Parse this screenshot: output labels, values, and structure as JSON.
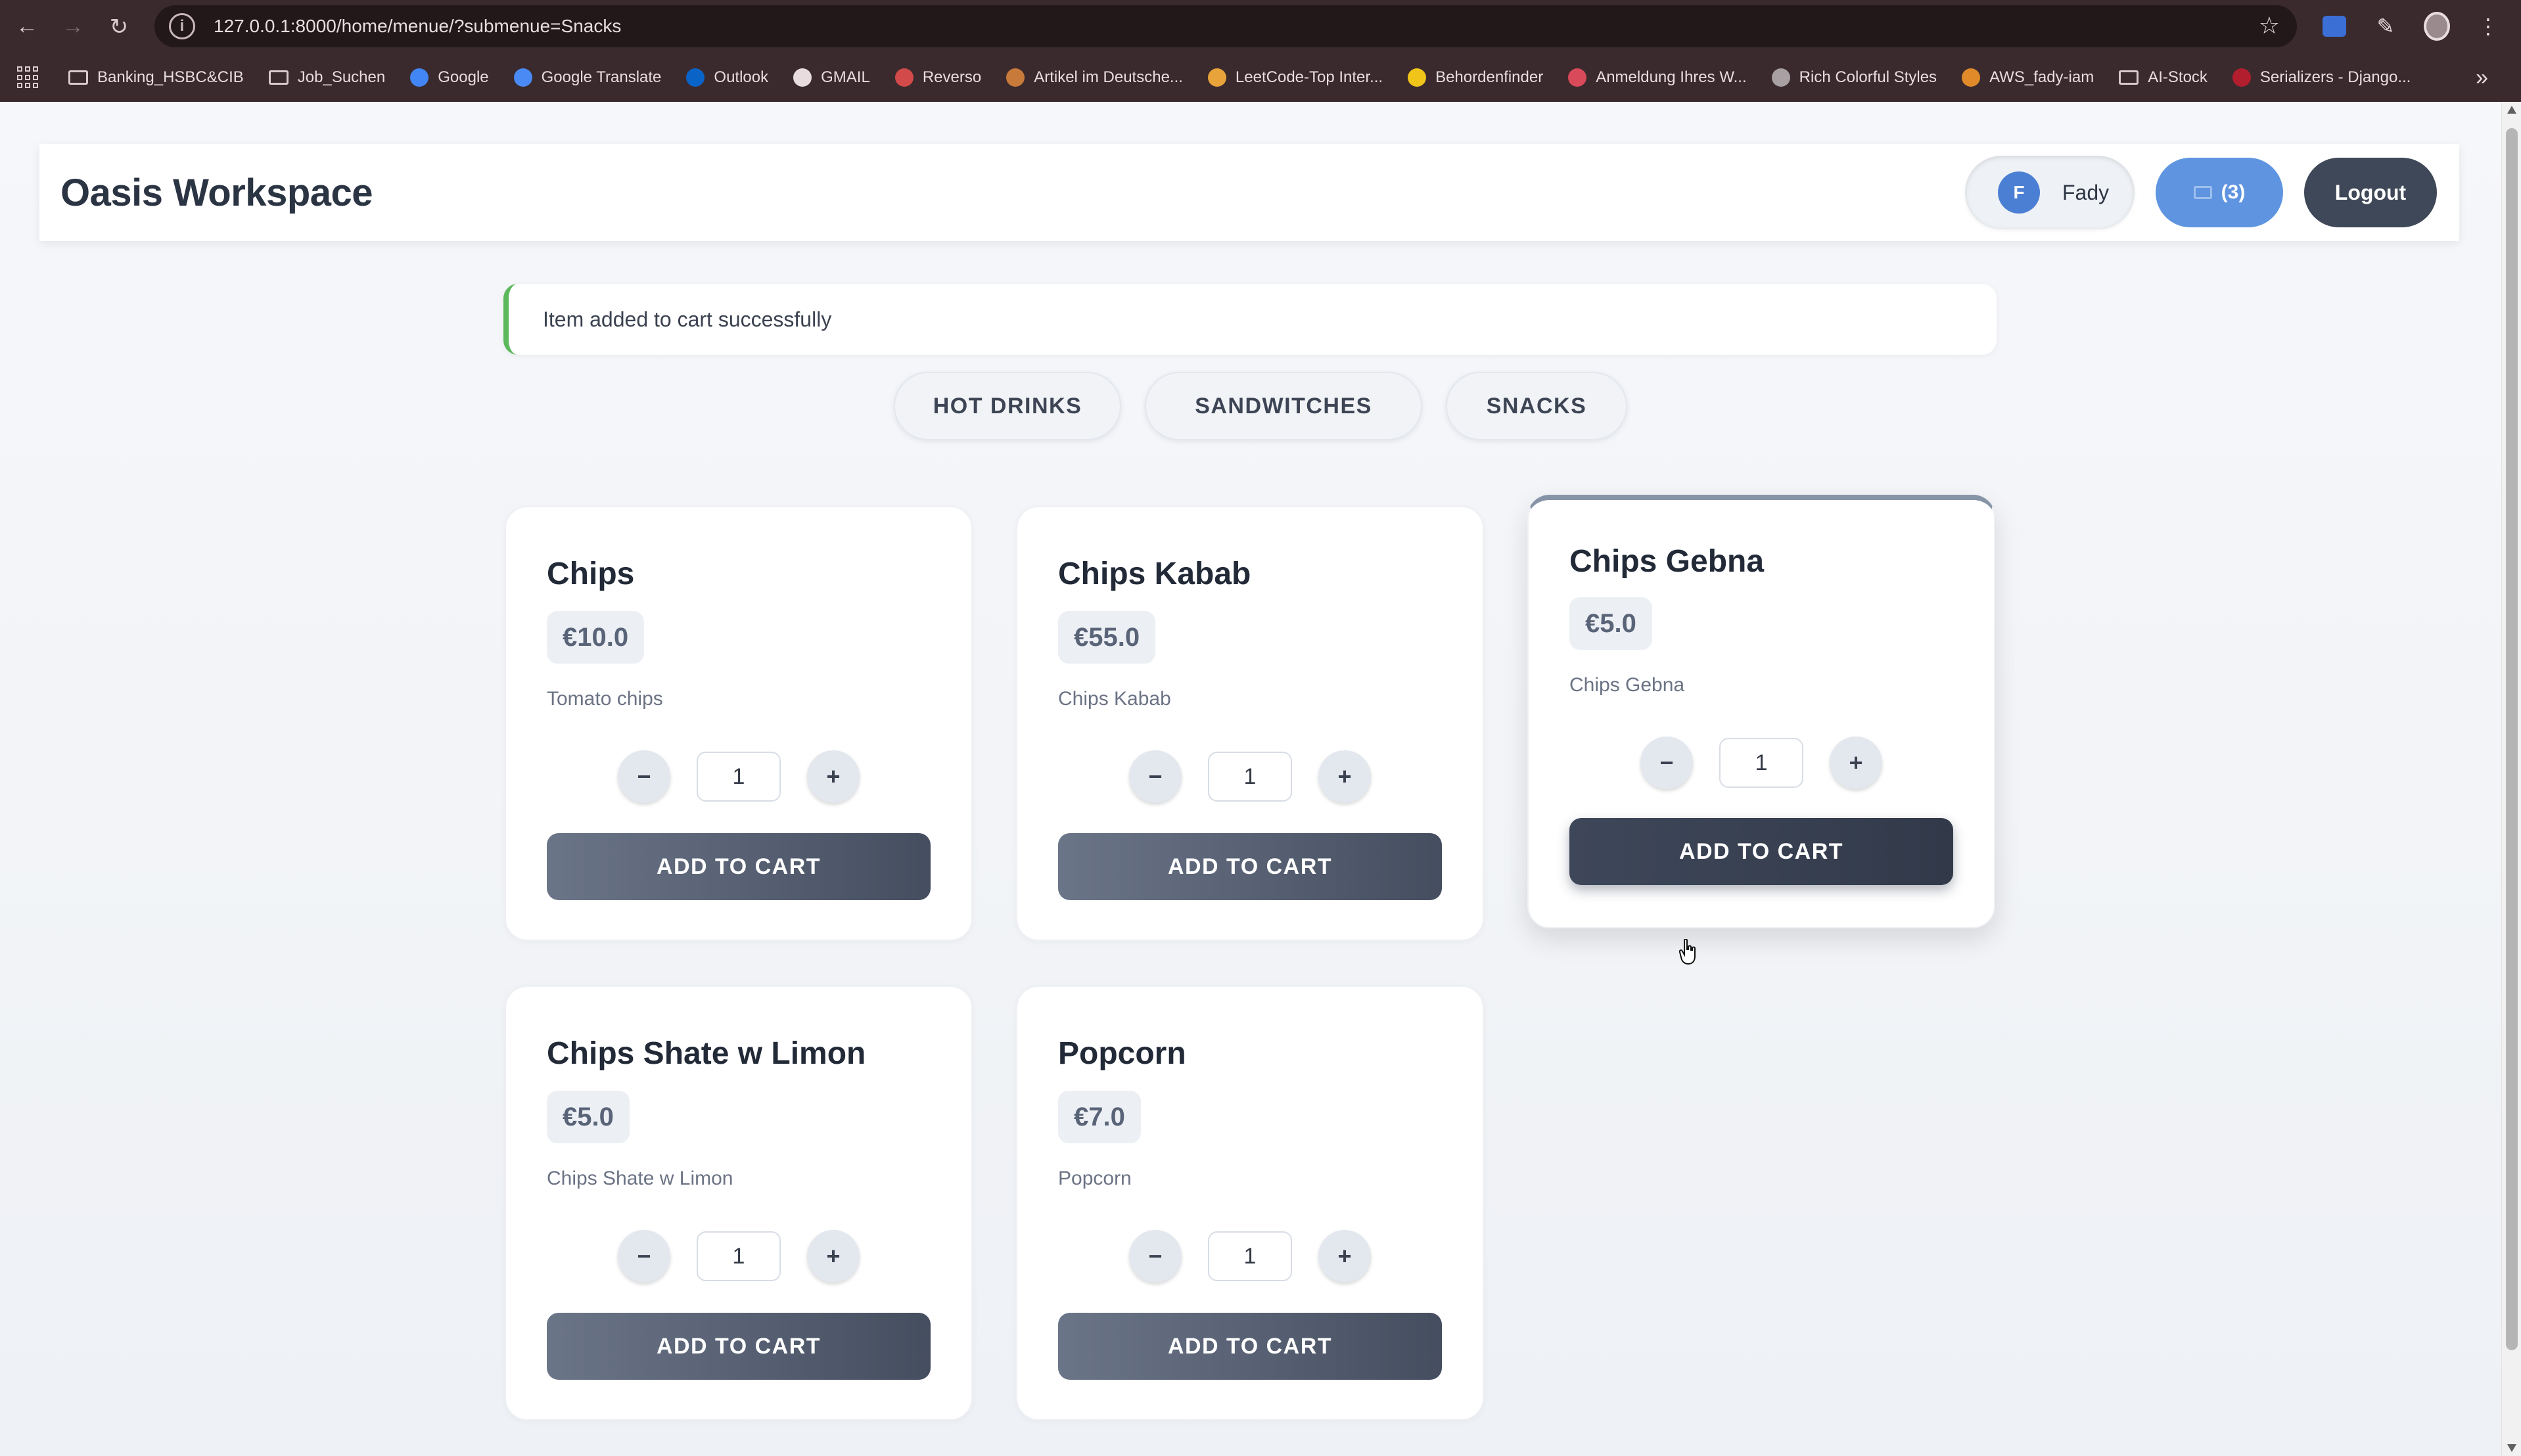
{
  "browser": {
    "url": "127.0.0.1:8000/home/menue/?submenue=Snacks",
    "bookmarks": [
      {
        "label": "Banking_HSBC&CIB",
        "icon": "folder-icon",
        "color": "#d8c9cc"
      },
      {
        "label": "Job_Suchen",
        "icon": "folder-icon",
        "color": "#d8c9cc"
      },
      {
        "label": "Google",
        "icon": "google-icon",
        "color": "#4285f4"
      },
      {
        "label": "Google Translate",
        "icon": "translate-icon",
        "color": "#4a8af4"
      },
      {
        "label": "Outlook",
        "icon": "outlook-icon",
        "color": "#0a64c8"
      },
      {
        "label": "GMAIL",
        "icon": "gmail-icon",
        "color": "#e8dcde"
      },
      {
        "label": "Reverso",
        "icon": "reverso-icon",
        "color": "#d24a4a"
      },
      {
        "label": "Artikel im Deutsche...",
        "icon": "article-icon",
        "color": "#c87a3a"
      },
      {
        "label": "LeetCode-Top Inter...",
        "icon": "leetcode-icon",
        "color": "#e8a33a"
      },
      {
        "label": "Behordenfinder",
        "icon": "behoerden-icon",
        "color": "#f0c419"
      },
      {
        "label": "Anmeldung Ihres W...",
        "icon": "anmeldung-icon",
        "color": "#d84a5a"
      },
      {
        "label": "Rich Colorful Styles",
        "icon": "globe-icon",
        "color": "#a8a0a2"
      },
      {
        "label": "AWS_fady-iam",
        "icon": "aws-icon",
        "color": "#e08a2a"
      },
      {
        "label": "AI-Stock",
        "icon": "folder-icon",
        "color": "#d8c9cc"
      },
      {
        "label": "Serializers - Django...",
        "icon": "django-icon",
        "color": "#b21e2e"
      }
    ]
  },
  "header": {
    "brand": "Oasis Workspace",
    "user_initial": "F",
    "user_name": "Fady",
    "cart_label": "(3)",
    "logout_label": "Logout"
  },
  "alert": {
    "message": "Item added to cart successfully",
    "color": "#5cb85c"
  },
  "tabs": [
    "HOT DRINKS",
    "SANDWITCHES",
    "SNACKS"
  ],
  "products": [
    {
      "name": "Chips",
      "price": "€10.0",
      "description": "Tomato chips",
      "quantity": "1",
      "button": "ADD TO CART"
    },
    {
      "name": "Chips Kabab",
      "price": "€55.0",
      "description": "Chips Kabab",
      "quantity": "1",
      "button": "ADD TO CART"
    },
    {
      "name": "Chips Gebna",
      "price": "€5.0",
      "description": "Chips Gebna",
      "quantity": "1",
      "button": "ADD TO CART"
    },
    {
      "name": "Chips Shate w Limon",
      "price": "€5.0",
      "description": "Chips Shate w Limon",
      "quantity": "1",
      "button": "ADD TO CART"
    },
    {
      "name": "Popcorn",
      "price": "€7.0",
      "description": "Popcorn",
      "quantity": "1",
      "button": "ADD TO CART"
    }
  ],
  "qty_controls": {
    "minus": "−",
    "plus": "+"
  }
}
